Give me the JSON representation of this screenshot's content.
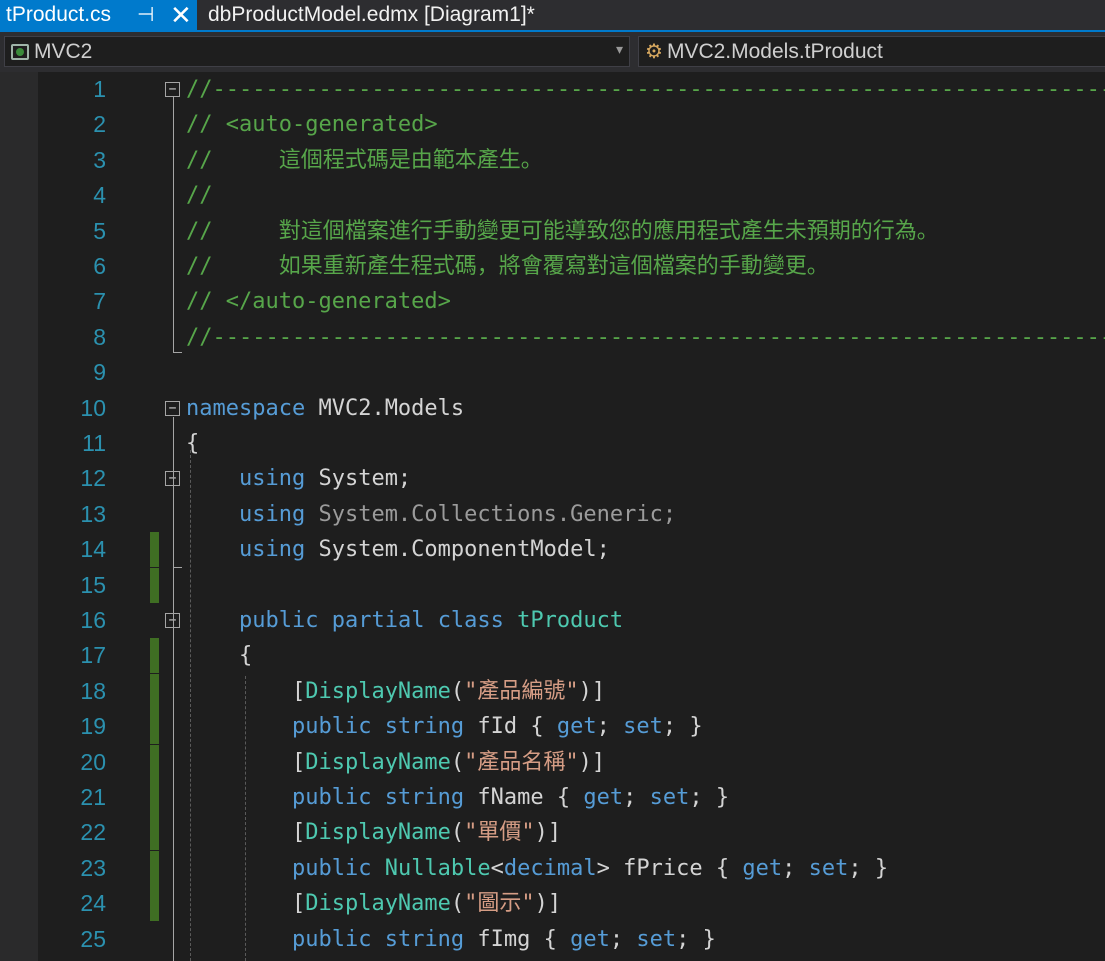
{
  "tabs": {
    "active": {
      "label": "tProduct.cs",
      "pin": "⊣",
      "close": "✕"
    },
    "inactive": {
      "label": "dbProductModel.edmx [Diagram1]*"
    }
  },
  "navbar": {
    "project": "MVC2",
    "class": "MVC2.Models.tProduct",
    "dropdown_arrow": "▾"
  },
  "icons": {
    "project": "csharp-project-icon",
    "class": "class-member-icon"
  },
  "colors": {
    "accent": "#007acc",
    "keyword": "#569cd6",
    "type": "#4ec9b0",
    "comment": "#57a64a",
    "string": "#d69d85",
    "line_number": "#2b91af",
    "change_bar": "#3f6e23"
  },
  "code": {
    "lines": [
      {
        "n": "1",
        "fold": "−",
        "changed": false,
        "tokens": [
          [
            "c",
            "//-----------------------------------------------------------------------------"
          ]
        ]
      },
      {
        "n": "2",
        "changed": false,
        "tokens": [
          [
            "c",
            "// <auto-generated>"
          ]
        ]
      },
      {
        "n": "3",
        "changed": false,
        "tokens": [
          [
            "c",
            "//     這個程式碼是由範本產生。"
          ]
        ]
      },
      {
        "n": "4",
        "changed": false,
        "tokens": [
          [
            "c",
            "//"
          ]
        ]
      },
      {
        "n": "5",
        "changed": false,
        "tokens": [
          [
            "c",
            "//     對這個檔案進行手動變更可能導致您的應用程式產生未預期的行為。"
          ]
        ]
      },
      {
        "n": "6",
        "changed": false,
        "tokens": [
          [
            "c",
            "//     如果重新產生程式碼，將會覆寫對這個檔案的手動變更。"
          ]
        ]
      },
      {
        "n": "7",
        "changed": false,
        "tokens": [
          [
            "c",
            "// </auto-generated>"
          ]
        ]
      },
      {
        "n": "8",
        "changed": false,
        "tokens": [
          [
            "c",
            "//-----------------------------------------------------------------------------"
          ]
        ]
      },
      {
        "n": "9",
        "changed": false,
        "tokens": []
      },
      {
        "n": "10",
        "fold": "−",
        "changed": false,
        "tokens": [
          [
            "k",
            "namespace"
          ],
          [
            "p",
            " MVC2.Models"
          ]
        ]
      },
      {
        "n": "11",
        "changed": false,
        "tokens": [
          [
            "p",
            "{"
          ]
        ]
      },
      {
        "n": "12",
        "fold": "−",
        "changed": false,
        "tokens": [
          [
            "p",
            "    "
          ],
          [
            "k",
            "using"
          ],
          [
            "p",
            " System;"
          ]
        ]
      },
      {
        "n": "13",
        "changed": false,
        "tokens": [
          [
            "p",
            "    "
          ],
          [
            "k",
            "using"
          ],
          [
            "g",
            " System.Collections.Generic;"
          ]
        ]
      },
      {
        "n": "14",
        "changed": true,
        "tokens": [
          [
            "p",
            "    "
          ],
          [
            "k",
            "using"
          ],
          [
            "p",
            " System.ComponentModel;"
          ]
        ]
      },
      {
        "n": "15",
        "changed": true,
        "tokens": []
      },
      {
        "n": "16",
        "fold": "−",
        "changed": false,
        "tokens": [
          [
            "p",
            "    "
          ],
          [
            "k",
            "public"
          ],
          [
            "p",
            " "
          ],
          [
            "k",
            "partial"
          ],
          [
            "p",
            " "
          ],
          [
            "k",
            "class"
          ],
          [
            "p",
            " "
          ],
          [
            "t",
            "tProduct"
          ]
        ]
      },
      {
        "n": "17",
        "changed": true,
        "tokens": [
          [
            "p",
            "    {"
          ]
        ]
      },
      {
        "n": "18",
        "changed": true,
        "tokens": [
          [
            "p",
            "        ["
          ],
          [
            "t",
            "DisplayName"
          ],
          [
            "p",
            "("
          ],
          [
            "s",
            "\"產品編號\""
          ],
          [
            "p",
            ")]"
          ]
        ]
      },
      {
        "n": "19",
        "changed": true,
        "tokens": [
          [
            "p",
            "        "
          ],
          [
            "k",
            "public"
          ],
          [
            "p",
            " "
          ],
          [
            "k",
            "string"
          ],
          [
            "p",
            " fId { "
          ],
          [
            "k",
            "get"
          ],
          [
            "p",
            "; "
          ],
          [
            "k",
            "set"
          ],
          [
            "p",
            "; }"
          ]
        ]
      },
      {
        "n": "20",
        "changed": true,
        "tokens": [
          [
            "p",
            "        ["
          ],
          [
            "t",
            "DisplayName"
          ],
          [
            "p",
            "("
          ],
          [
            "s",
            "\"產品名稱\""
          ],
          [
            "p",
            ")]"
          ]
        ]
      },
      {
        "n": "21",
        "changed": true,
        "tokens": [
          [
            "p",
            "        "
          ],
          [
            "k",
            "public"
          ],
          [
            "p",
            " "
          ],
          [
            "k",
            "string"
          ],
          [
            "p",
            " fName { "
          ],
          [
            "k",
            "get"
          ],
          [
            "p",
            "; "
          ],
          [
            "k",
            "set"
          ],
          [
            "p",
            "; }"
          ]
        ]
      },
      {
        "n": "22",
        "changed": true,
        "tokens": [
          [
            "p",
            "        ["
          ],
          [
            "t",
            "DisplayName"
          ],
          [
            "p",
            "("
          ],
          [
            "s",
            "\"單價\""
          ],
          [
            "p",
            ")]"
          ]
        ]
      },
      {
        "n": "23",
        "changed": true,
        "tokens": [
          [
            "p",
            "        "
          ],
          [
            "k",
            "public"
          ],
          [
            "p",
            " "
          ],
          [
            "t",
            "Nullable"
          ],
          [
            "p",
            "<"
          ],
          [
            "k",
            "decimal"
          ],
          [
            "p",
            "> fPrice { "
          ],
          [
            "k",
            "get"
          ],
          [
            "p",
            "; "
          ],
          [
            "k",
            "set"
          ],
          [
            "p",
            "; }"
          ]
        ]
      },
      {
        "n": "24",
        "changed": true,
        "tokens": [
          [
            "p",
            "        ["
          ],
          [
            "t",
            "DisplayName"
          ],
          [
            "p",
            "("
          ],
          [
            "s",
            "\"圖示\""
          ],
          [
            "p",
            ")]"
          ]
        ]
      },
      {
        "n": "25",
        "changed": false,
        "tokens": [
          [
            "p",
            "        "
          ],
          [
            "k",
            "public"
          ],
          [
            "p",
            " "
          ],
          [
            "k",
            "string"
          ],
          [
            "p",
            " fImg { "
          ],
          [
            "k",
            "get"
          ],
          [
            "p",
            "; "
          ],
          [
            "k",
            "set"
          ],
          [
            "p",
            "; }"
          ]
        ]
      }
    ]
  }
}
